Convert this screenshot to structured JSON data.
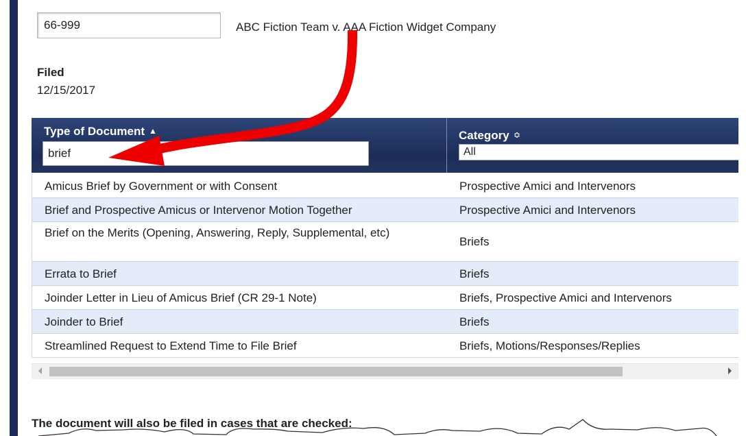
{
  "case": {
    "number_value": "66-999",
    "title": "ABC Fiction Team v. AAA Fiction Widget Company"
  },
  "filed": {
    "label": "Filed",
    "date": "12/15/2017"
  },
  "grid": {
    "columns": {
      "type": {
        "label": "Type of Document",
        "sort_glyph": "▲",
        "filter_value": "brief"
      },
      "category": {
        "label": "Category",
        "sort_glyph": "≎",
        "filter_value": "All"
      }
    },
    "rows": [
      {
        "type": "Amicus Brief by Government or with Consent",
        "category": "Prospective Amici and Intervenors"
      },
      {
        "type": "Brief and Prospective Amicus or Intervenor Motion Together",
        "category": "Prospective Amici and Intervenors"
      },
      {
        "type": "Brief on the Merits (Opening, Answering, Reply, Supplemental, etc)",
        "category": "Briefs"
      },
      {
        "type": "Errata to Brief",
        "category": "Briefs"
      },
      {
        "type": "Joinder Letter in Lieu of Amicus Brief (CR 29-1 Note)",
        "category": "Briefs, Prospective Amici and Intervenors"
      },
      {
        "type": "Joinder to Brief",
        "category": "Briefs"
      },
      {
        "type": "Streamlined Request to Extend Time to File Brief",
        "category": "Briefs, Motions/Responses/Replies"
      }
    ],
    "scrollbar": {
      "left_icon": "scroll-left-arrow-icon",
      "right_icon": "scroll-right-arrow-icon",
      "thumb_fraction": 0.81
    }
  },
  "also_filed": {
    "label": "The document will also be filed in cases that are checked:"
  },
  "annotation": {
    "arrow_icon": "curved-red-arrow-icon",
    "arrow_color": "#ee0000"
  },
  "colors": {
    "header_bg": "#1c2c56",
    "row_alt_bg": "#e3ecf8",
    "left_bar": "#1c2a5a"
  }
}
